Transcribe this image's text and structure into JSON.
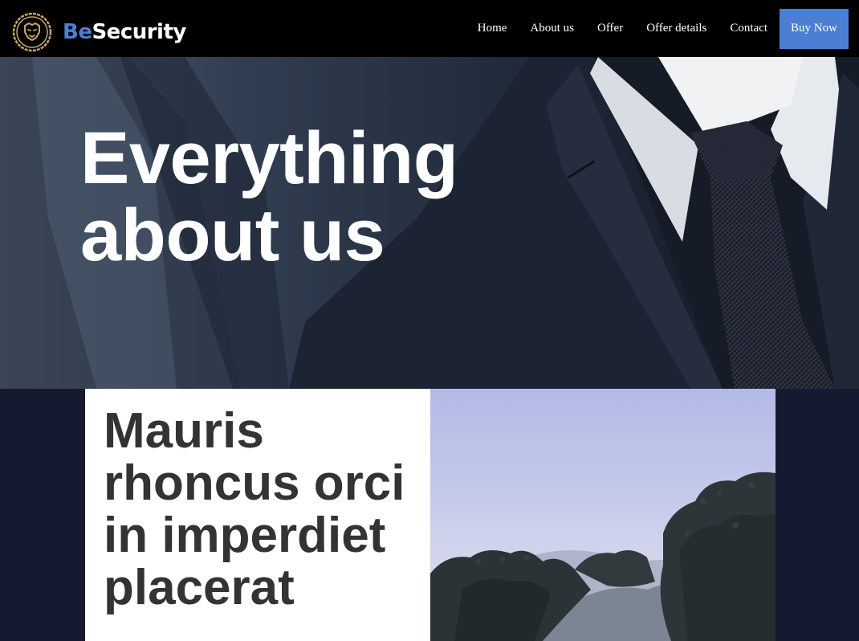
{
  "brand": {
    "prefix": "Be",
    "suffix": "Security",
    "accent_color": "#4a7fd4"
  },
  "nav": {
    "items": [
      {
        "label": "Home"
      },
      {
        "label": "About us"
      },
      {
        "label": "Offer"
      },
      {
        "label": "Offer details"
      },
      {
        "label": "Contact"
      }
    ],
    "cta_label": "Buy Now"
  },
  "hero": {
    "title_line1": "Everything",
    "title_line2": "about us",
    "image": "businessman-suit-tie-photo"
  },
  "section": {
    "heading": "Mauris rhoncus orci in imperdiet placerat",
    "image": "hillside-shrubs-landscape-photo"
  },
  "icons": {
    "logo": "lion-badge-icon"
  }
}
